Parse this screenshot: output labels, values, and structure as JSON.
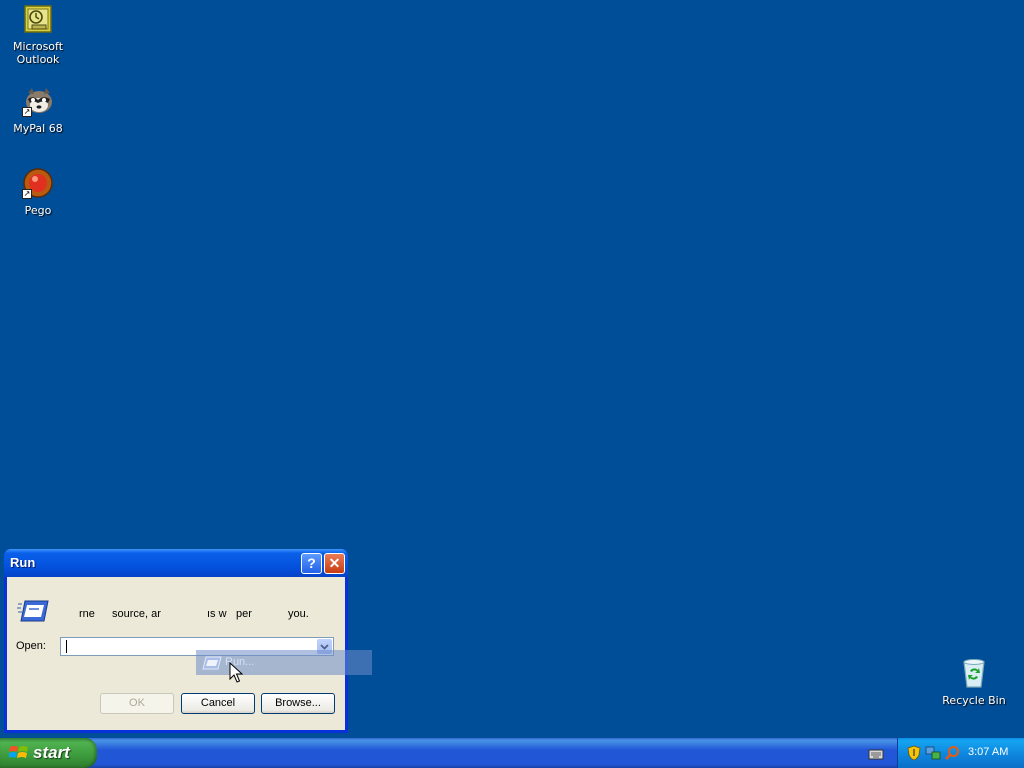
{
  "desktop": {
    "icons": [
      {
        "label_line1": "Microsoft",
        "label_line2": "Outlook"
      },
      {
        "label_line1": "MyPal 68"
      },
      {
        "label_line1": "Pego"
      },
      {
        "label_line1": "Recycle Bin"
      }
    ]
  },
  "run_dialog": {
    "title": "Run",
    "help_button": "?",
    "close_button": "✕",
    "description_fragments": [
      "rne",
      "source, ar",
      "ıs w",
      "per",
      "you."
    ],
    "open_label": "Open:",
    "open_value": "",
    "ok_label": "OK",
    "cancel_label": "Cancel",
    "browse_label": "Browse..."
  },
  "drag_ghost": {
    "label": "Run..."
  },
  "taskbar": {
    "start_label": "start",
    "clock": "3:07 AM"
  },
  "colors": {
    "desktop_bg": "#004e98",
    "title_bar": "#0453df",
    "taskbar": "#2157d7",
    "start_button": "#3c9a3c",
    "dialog_face": "#ece9d8"
  }
}
